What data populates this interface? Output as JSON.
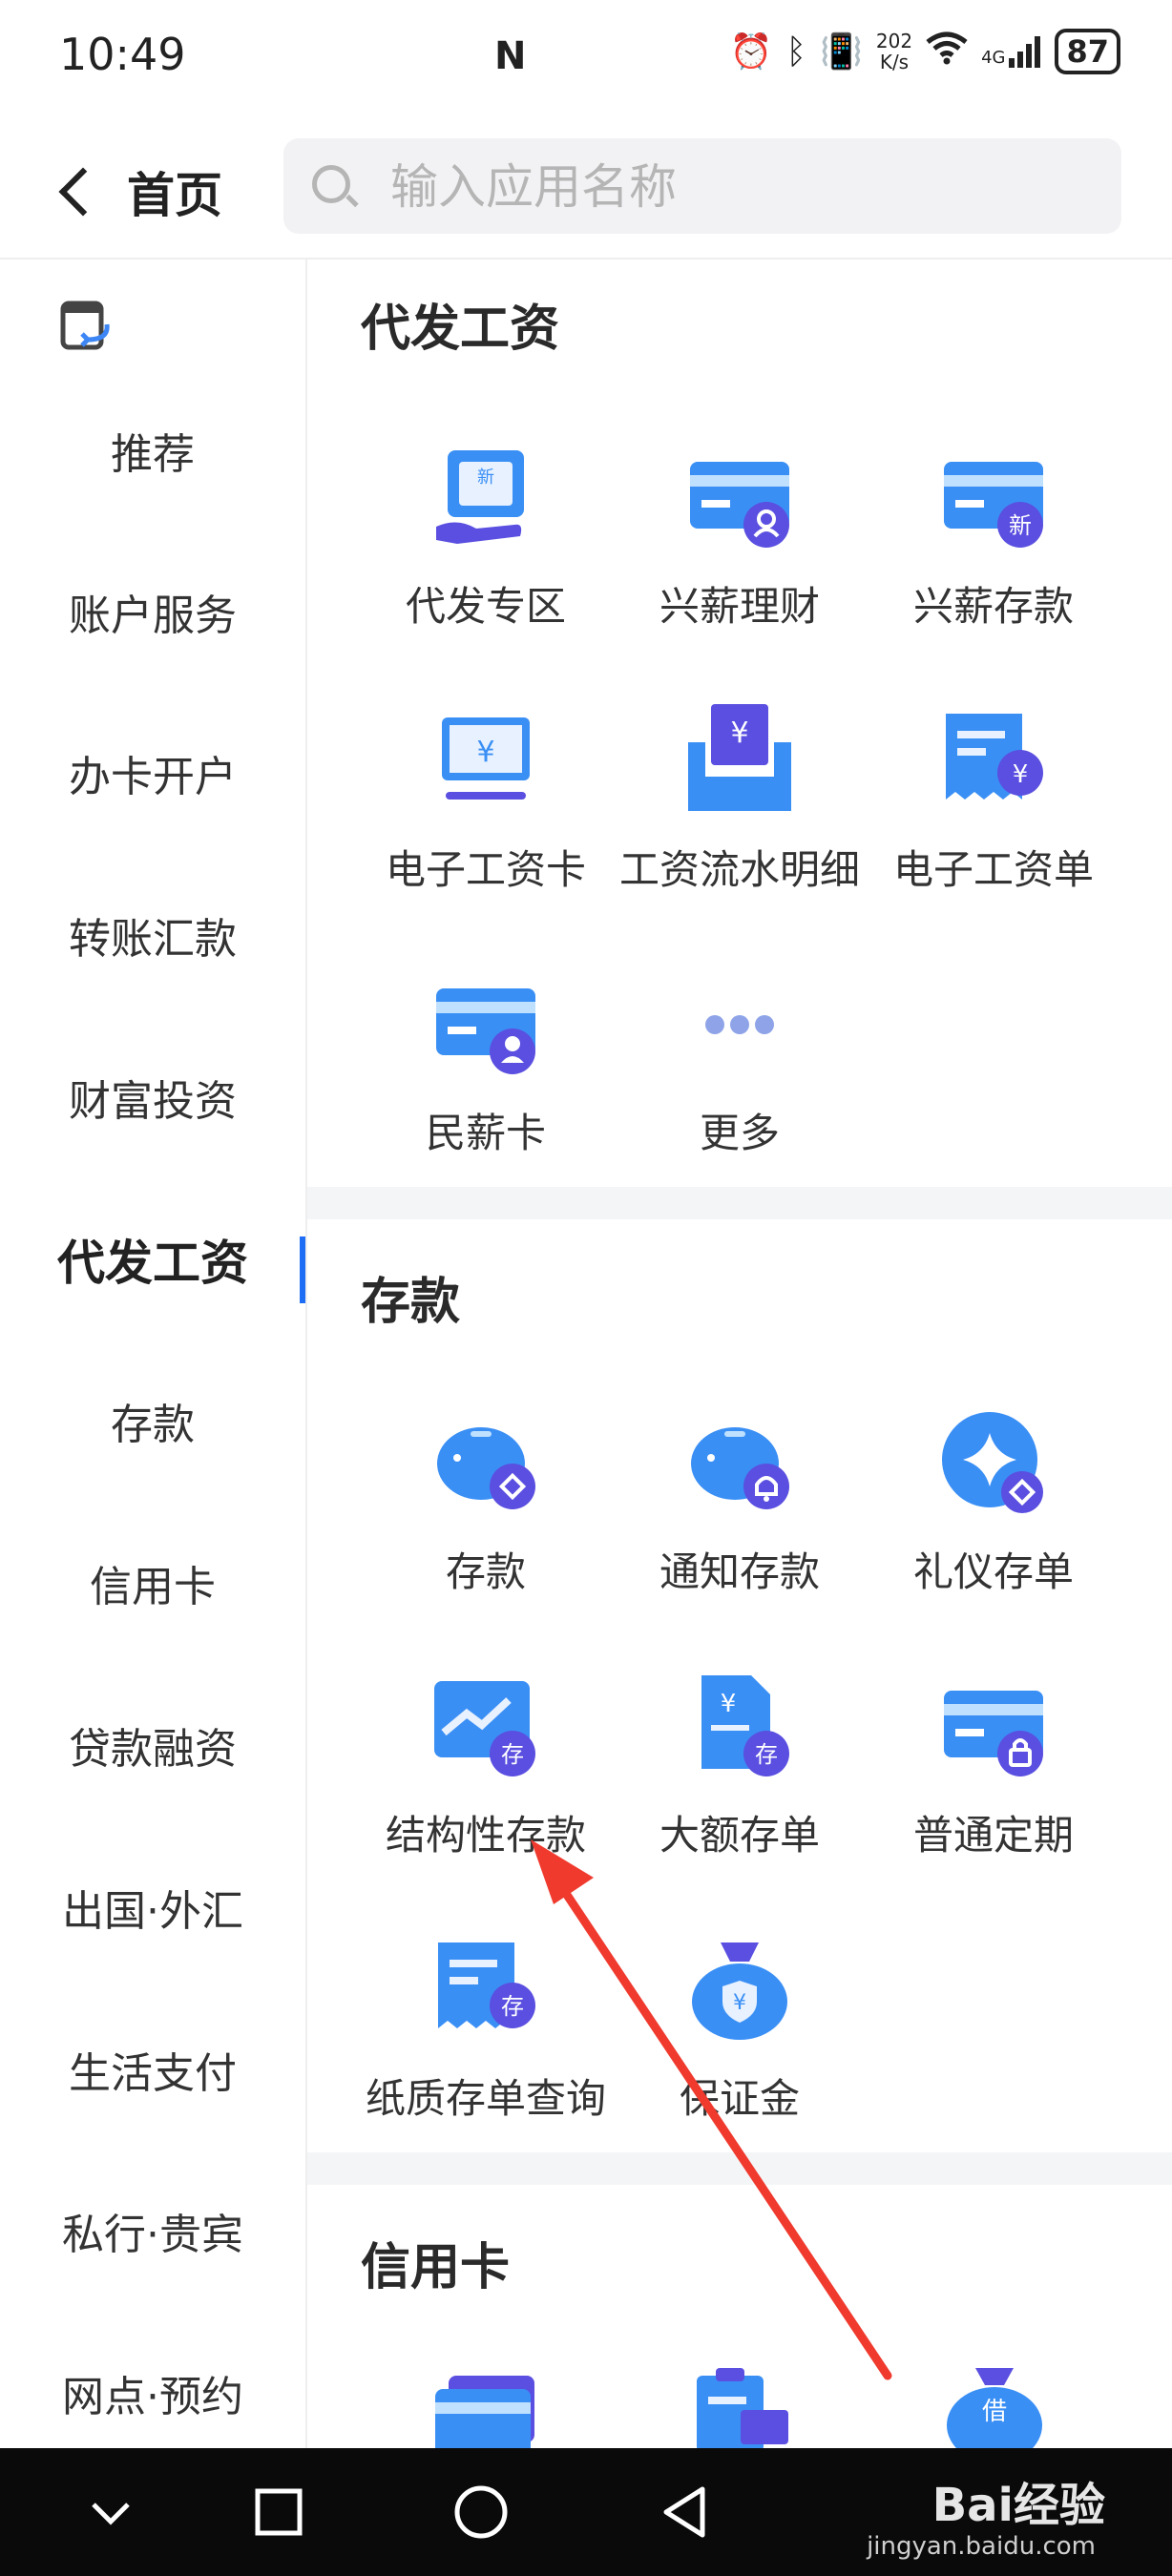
{
  "status_bar": {
    "time": "10:49",
    "nfc": "N",
    "net_speed_value": "202",
    "net_speed_unit": "K/s",
    "network": "4G",
    "battery": "87"
  },
  "header": {
    "back_label": "首页",
    "search_placeholder": "输入应用名称"
  },
  "sidebar": {
    "items": [
      {
        "label": "推荐"
      },
      {
        "label": "账户服务"
      },
      {
        "label": "办卡开户"
      },
      {
        "label": "转账汇款"
      },
      {
        "label": "财富投资"
      },
      {
        "label": "代发工资",
        "active": true
      },
      {
        "label": "存款"
      },
      {
        "label": "信用卡"
      },
      {
        "label": "贷款融资"
      },
      {
        "label": "出国·外汇"
      },
      {
        "label": "生活支付"
      },
      {
        "label": "私行·贵宾"
      },
      {
        "label": "网点·预约"
      }
    ]
  },
  "sections": {
    "payroll": {
      "title": "代发工资",
      "items": [
        {
          "label": "代发专区",
          "icon": "payroll-zone-icon"
        },
        {
          "label": "兴薪理财",
          "icon": "card-user-icon"
        },
        {
          "label": "兴薪存款",
          "icon": "card-new-icon"
        },
        {
          "label": "电子工资卡",
          "icon": "monitor-yuan-icon"
        },
        {
          "label": "工资流水明细",
          "icon": "tray-yuan-icon"
        },
        {
          "label": "电子工资单",
          "icon": "receipt-yuan-icon"
        },
        {
          "label": "民薪卡",
          "icon": "card-person-icon"
        },
        {
          "label": "更多",
          "icon": "more-dots-icon"
        }
      ],
      "badge_new": "新",
      "badge_yuan": "¥"
    },
    "deposit": {
      "title": "存款",
      "items": [
        {
          "label": "存款",
          "icon": "piggy-bank-icon"
        },
        {
          "label": "通知存款",
          "icon": "piggy-bell-icon"
        },
        {
          "label": "礼仪存单",
          "icon": "gift-circle-icon"
        },
        {
          "label": "结构性存款",
          "icon": "chart-deposit-icon"
        },
        {
          "label": "大额存单",
          "icon": "document-deposit-icon"
        },
        {
          "label": "普通定期",
          "icon": "card-lock-icon"
        },
        {
          "label": "纸质存单查询",
          "icon": "receipt-deposit-icon"
        },
        {
          "label": "保证金",
          "icon": "money-bag-icon"
        }
      ],
      "badge_deposit": "存"
    },
    "credit": {
      "title": "信用卡",
      "badge_borrow": "借"
    }
  },
  "watermark": {
    "text": "Bai经验",
    "sub": "jingyan.baidu.com"
  },
  "colors": {
    "accent": "#1e6ef5",
    "icon_blue": "#2f8cf5",
    "badge_purple": "#5a4fe0",
    "arrow_red": "#f03a2e"
  }
}
